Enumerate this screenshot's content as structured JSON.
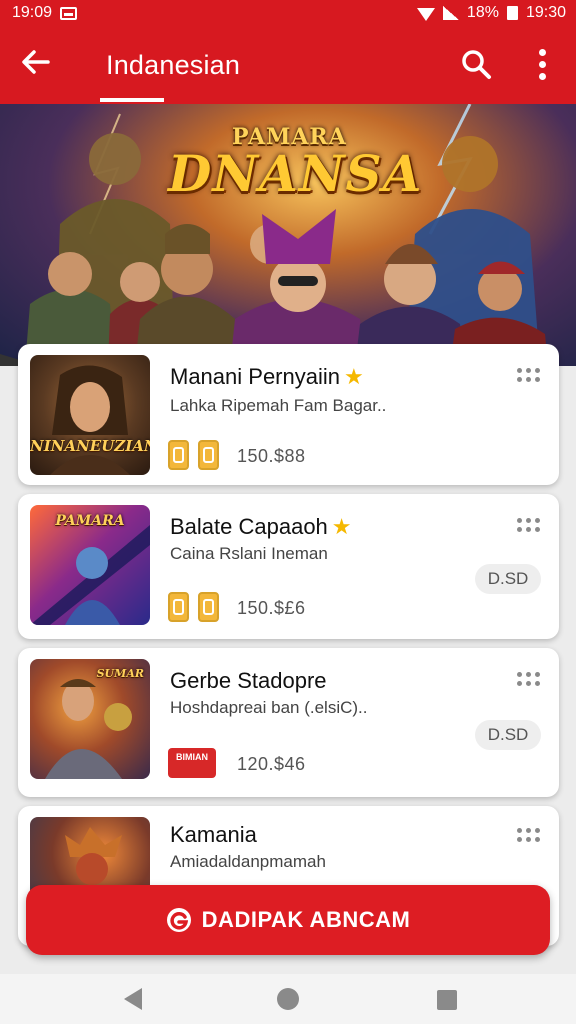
{
  "status_bar": {
    "time_left": "19:09",
    "battery_percent": "18%",
    "time_right": "19:30"
  },
  "app_bar": {
    "title": "Indanesian",
    "back_icon": "arrow-back-icon",
    "search_icon": "search-icon",
    "more_icon": "more-vert-icon"
  },
  "banner": {
    "title_top": "PAMARA",
    "title_main": "DNANSA"
  },
  "games": [
    {
      "title": "Manani Pernyaiin",
      "starred": true,
      "subtitle": "Lahka Ripemah Fam Bagar..",
      "thumb_label": "NINANEUZIAN",
      "price": "150.$88"
    },
    {
      "title": "Balate Capaaoh",
      "starred": true,
      "subtitle": "Caina Rslani Ineman",
      "thumb_label": "PAMARA",
      "price": "150.$£6",
      "pill": "D.SD"
    },
    {
      "title": "Gerbe Stadopre",
      "starred": false,
      "subtitle": "Hoshdapreai ban (.elsiC)..",
      "thumb_label": "SUMAR",
      "badge_text": "BIMIAN",
      "price": "120.$46",
      "pill": "D.SD"
    },
    {
      "title": "Kamania",
      "starred": false,
      "subtitle": "Amiadaldanpmamah"
    }
  ],
  "cta": {
    "label": "DADIPAK ABNCAM",
    "icon": "refresh-g-icon"
  },
  "nav": {
    "back_icon": "nav-back-icon",
    "home_icon": "nav-home-icon",
    "recent_icon": "nav-recents-icon"
  },
  "colors": {
    "primary": "#d71920",
    "star": "#f5b800",
    "badge": "#f3b73a"
  }
}
